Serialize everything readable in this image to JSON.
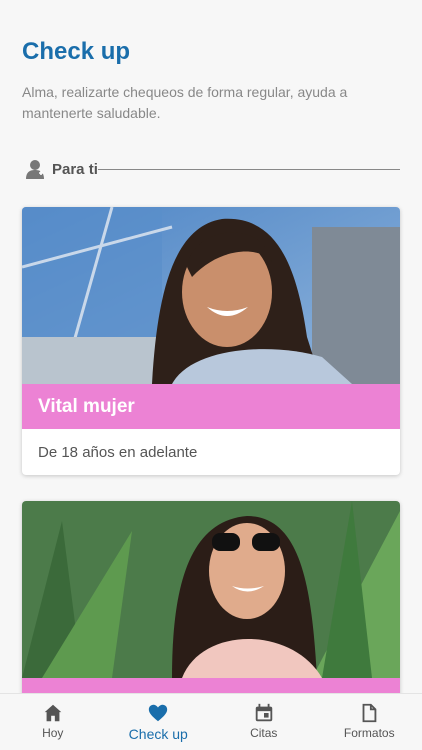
{
  "header": {
    "title": "Check up",
    "subtitle": "Alma, realizarte chequeos de forma regular, ayuda a mantenerte saludable."
  },
  "section": {
    "label": "Para ti",
    "icon": "user-doctor-icon"
  },
  "cards": [
    {
      "title": "Vital mujer",
      "description": "De 18 años en adelante",
      "image": "woman-smiling-photo"
    },
    {
      "title": "",
      "description": "",
      "image": "woman-sunglasses-photo"
    }
  ],
  "tabs": [
    {
      "label": "Hoy",
      "icon": "home-icon",
      "active": false
    },
    {
      "label": "Check up",
      "icon": "heart-icon",
      "active": true
    },
    {
      "label": "Citas",
      "icon": "calendar-icon",
      "active": false
    },
    {
      "label": "Formatos",
      "icon": "document-icon",
      "active": false
    }
  ],
  "colors": {
    "primary": "#1a6eab",
    "banner": "#ec82d4"
  }
}
